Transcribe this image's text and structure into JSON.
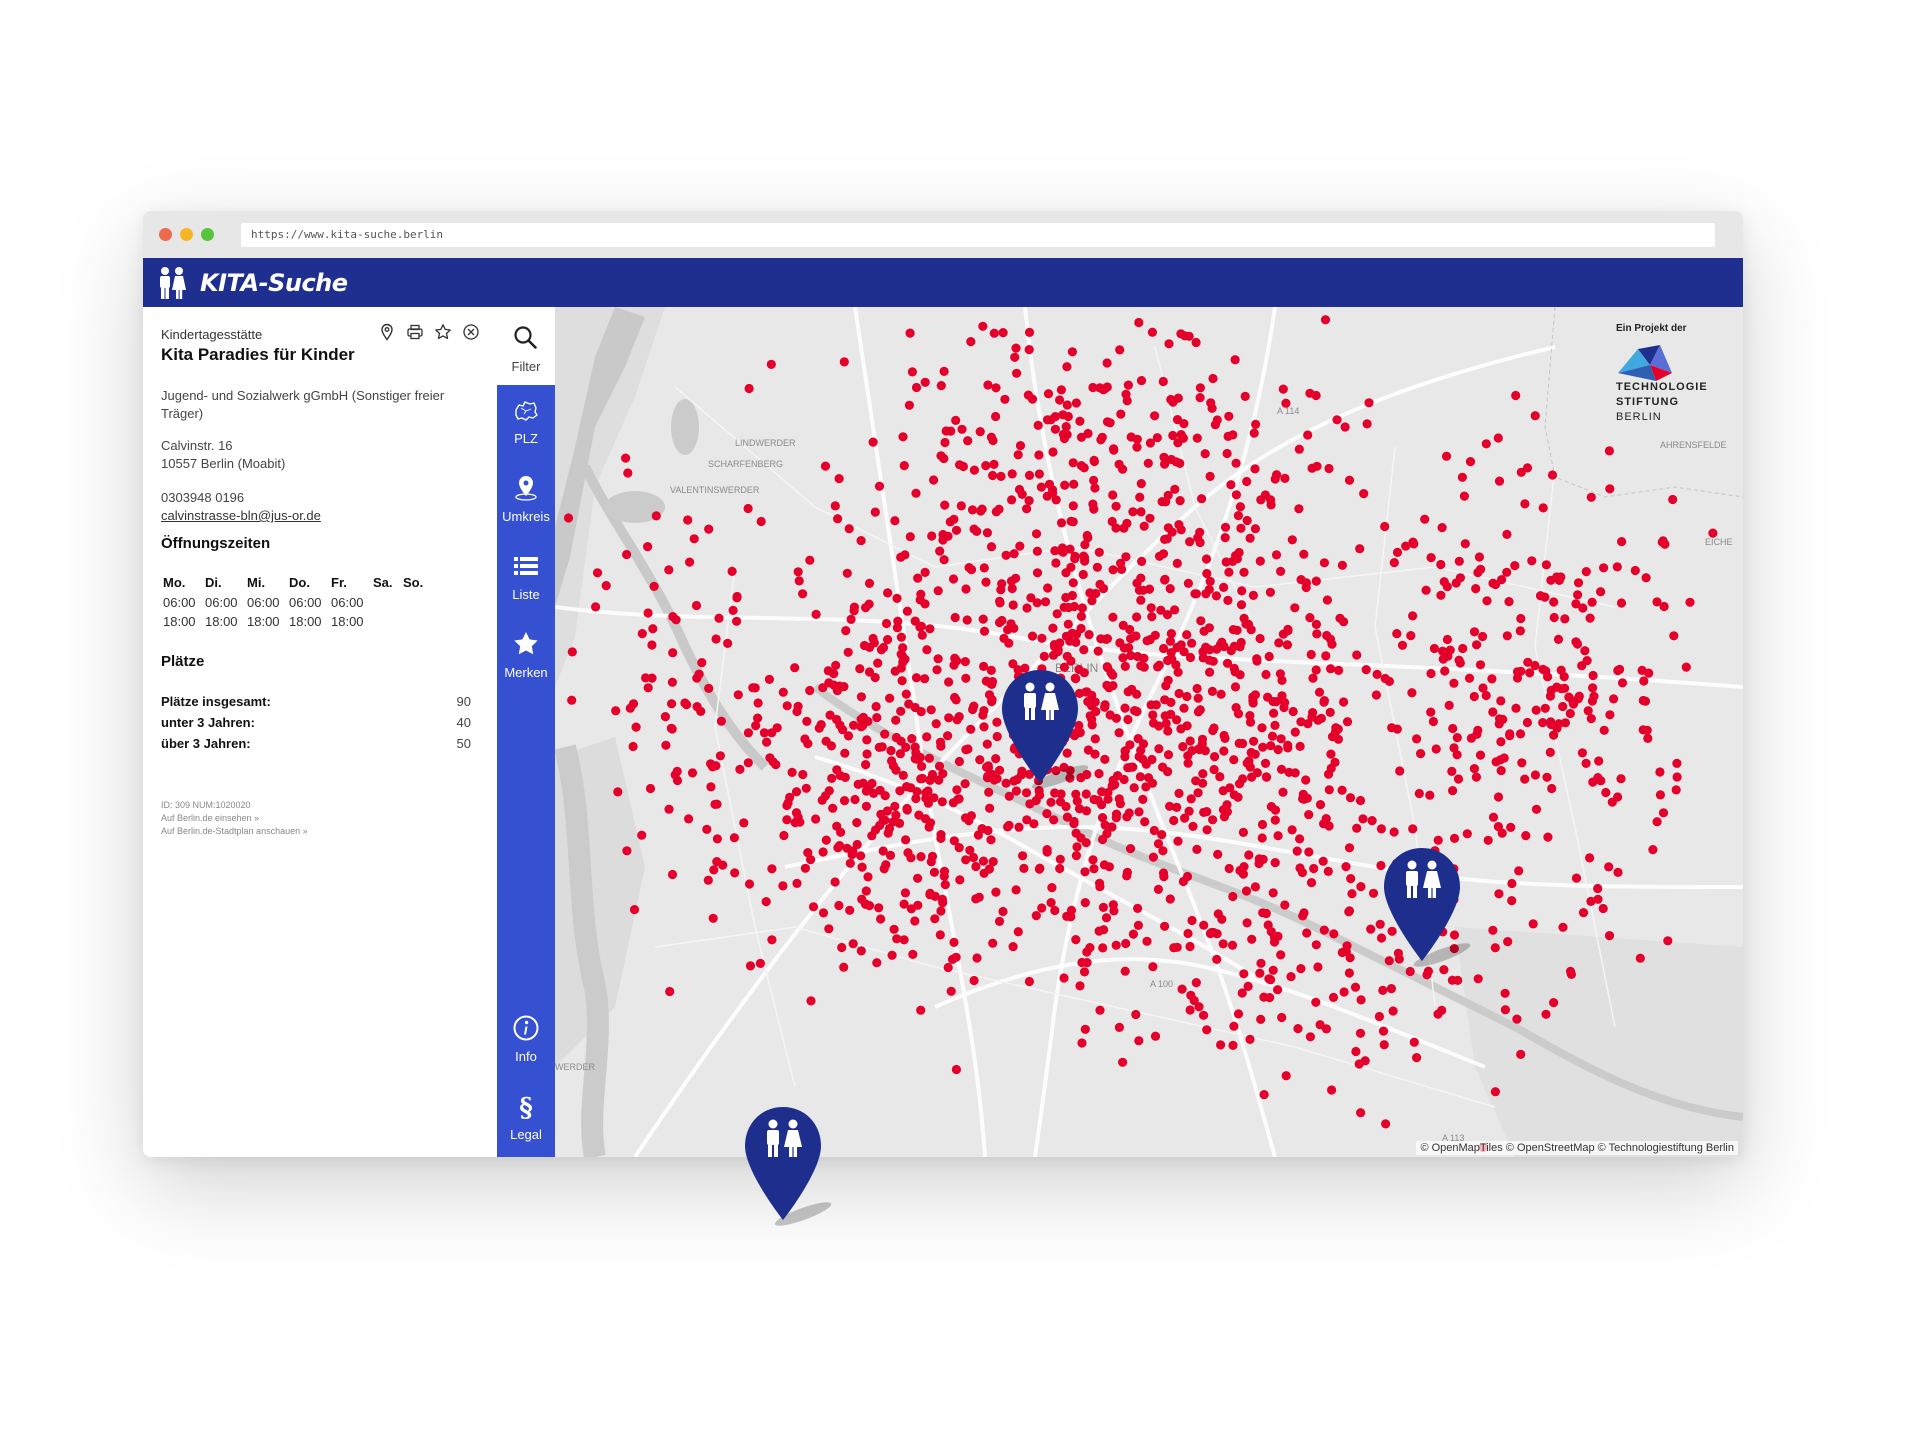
{
  "browser": {
    "url": "https://www.kita-suche.berlin"
  },
  "app": {
    "title": "KITA-Suche"
  },
  "detail": {
    "type": "Kindertagesstätte",
    "name": "Kita Paradies für Kinder",
    "operator": "Jugend- und Sozialwerk gGmbH (Sonstiger freier Träger)",
    "street": "Calvinstr. 16",
    "city": "10557 Berlin (Moabit)",
    "phone": "0303948 0196",
    "email": "calvinstrasse-bln@jus-or.de",
    "hours_title": "Öffnungszeiten",
    "hours": [
      {
        "day": "Mo.",
        "open": "06:00",
        "close": "18:00"
      },
      {
        "day": "Di.",
        "open": "06:00",
        "close": "18:00"
      },
      {
        "day": "Mi.",
        "open": "06:00",
        "close": "18:00"
      },
      {
        "day": "Do.",
        "open": "06:00",
        "close": "18:00"
      },
      {
        "day": "Fr.",
        "open": "06:00",
        "close": "18:00"
      },
      {
        "day": "Sa.",
        "open": "",
        "close": ""
      },
      {
        "day": "So.",
        "open": "",
        "close": ""
      }
    ],
    "places_title": "Plätze",
    "places": [
      {
        "label": "Plätze insgesamt:",
        "value": "90"
      },
      {
        "label": "unter 3 Jahren:",
        "value": "40"
      },
      {
        "label": "über 3 Jahren:",
        "value": "50"
      }
    ],
    "id_line": "ID: 309 NUM:1020020",
    "link1": "Auf Berlin.de einsehen »",
    "link2": "Auf Berlin.de-Stadtplan anschauen »",
    "actions": [
      "map-marker-icon",
      "print-icon",
      "star-outline-icon",
      "close-circle-icon"
    ]
  },
  "sidebar": {
    "filter": "Filter",
    "plz": "PLZ",
    "umkreis": "Umkreis",
    "liste": "Liste",
    "merken": "Merken",
    "info": "Info",
    "legal": "Legal"
  },
  "map": {
    "labels": {
      "berlin": "BERLIN",
      "lindwerder": "LINDWERDER",
      "scharfenberg": "SCHARFENBERG",
      "valentinswerder": "VALENTINSWERDER",
      "ahrensfelde": "AHRENSFELDE",
      "eiche": "EICHE",
      "a114": "A 114",
      "a100": "A 100",
      "a113": "A 113",
      "werder": "WERDER"
    },
    "project_label": "Ein Projekt der",
    "org_line1": "TECHNOLOGIE",
    "org_line2": "STIFTUNG",
    "org_line3": "BERLIN",
    "attribution": "© OpenMapTiles © OpenStreetMap © Technologiestiftung Berlin",
    "dot_color": "#e4002b"
  },
  "colors": {
    "appbar": "#1e2f8f",
    "sidebar": "#3550d0",
    "pin": "#1d2e8c"
  }
}
